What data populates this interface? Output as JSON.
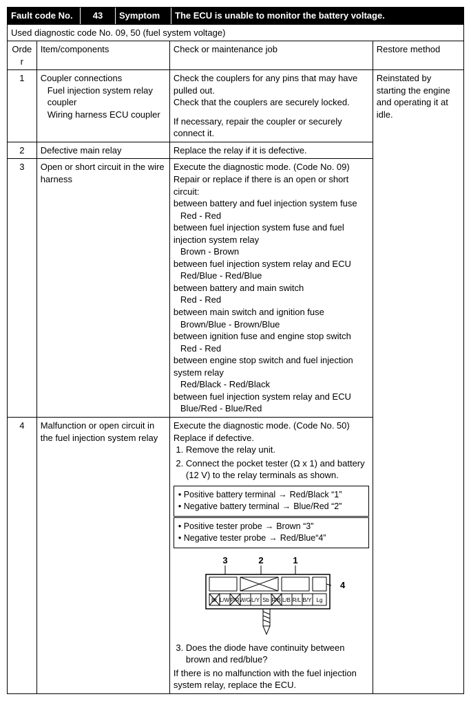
{
  "header": {
    "fault_label": "Fault code No.",
    "fault_value": "43",
    "symptom_label": "Symptom",
    "symptom_value": "The ECU is unable to monitor the battery voltage."
  },
  "diag_note": "Used diagnostic code No. 09, 50 (fuel system voltage)",
  "col_headers": {
    "order": "Order",
    "item": "Item/components",
    "check": "Check or maintenance job",
    "restore": "Restore method"
  },
  "restore_text": "Reinstated by starting the engine and operating it at idle.",
  "rows": {
    "r1": {
      "order": "1",
      "item_title": "Coupler connections",
      "item_line1": "Fuel injection system relay coupler",
      "item_line2": "Wiring harness ECU coupler",
      "check_p1": "Check the couplers for any pins that may have pulled out.",
      "check_p2": "Check that the couplers are securely locked.",
      "check_p3": "If necessary, repair the coupler or securely connect it."
    },
    "r2": {
      "order": "2",
      "item": "Defective main relay",
      "check": "Replace the relay if it is defective."
    },
    "r3": {
      "order": "3",
      "item": "Open or short circuit in the wire harness",
      "check_intro": "Execute the diagnostic mode. (Code No. 09)\nRepair or replace if there is an open or short circuit:",
      "lines": {
        "a": "between battery and fuel injection system fuse",
        "a_c": "Red - Red",
        "b": "between fuel injection system fuse and fuel injection system relay",
        "b_c": "Brown - Brown",
        "c": "between fuel injection system relay and ECU",
        "c_c": "Red/Blue - Red/Blue",
        "d": "between battery and main switch",
        "d_c": "Red - Red",
        "e": "between main switch and ignition fuse",
        "e_c": "Brown/Blue - Brown/Blue",
        "f": "between ignition fuse and engine stop switch",
        "f_c": "Red - Red",
        "g": "between engine stop switch and fuel injection system relay",
        "g_c": "Red/Black - Red/Black",
        "h": "between fuel injection system relay and ECU",
        "h_c": "Blue/Red - Blue/Red"
      }
    },
    "r4": {
      "order": "4",
      "item": "Malfunction or open circuit in the fuel injection system relay",
      "check_intro": "Execute the diagnostic mode. (Code No. 50)\nReplace if defective.",
      "step1": "Remove the relay unit.",
      "step2": "Connect the pocket tester (Ω x 1) and battery (12 V) to the relay terminals as shown.",
      "box1": {
        "l1a": "Positive battery terminal",
        "l1b": "Red/Black “1”",
        "l2a": "Negative battery terminal",
        "l2b": "Blue/Red “2”"
      },
      "box2": {
        "l1a": "Positive tester probe",
        "l1b": "Brown “3”",
        "l2a": "Negative tester probe",
        "l2b": "Red/Blue“4”"
      },
      "connector": {
        "top": {
          "n1": "1",
          "n2": "2",
          "n3": "3",
          "n4": "4"
        },
        "bottom_labels": [
          "Br",
          "L/W",
          "P/R",
          "W/G",
          "L/Y",
          "Sb",
          "R/B",
          "L/B",
          "R/L",
          "B/Y",
          "Lg"
        ]
      },
      "step3": "Does the diode have continuity between brown and red/blue?",
      "tail": "If there is no malfunction with the fuel injection system relay, replace the ECU."
    }
  }
}
